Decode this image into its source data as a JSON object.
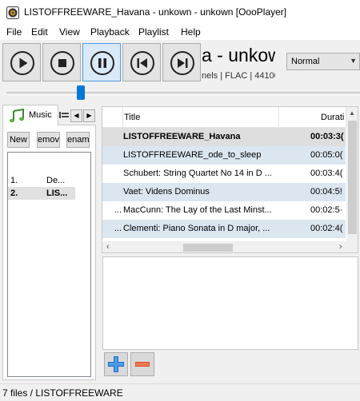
{
  "window": {
    "title": "LISTOFFREEWARE_Havana - unkown - unkown [OooPlayer]"
  },
  "menu": [
    "File",
    "Edit",
    "View",
    "Playback",
    "Playlist",
    "Help"
  ],
  "now_playing": {
    "title_scroll": "a - unkow",
    "info_scroll": "nels | FLAC | 44100"
  },
  "mode_select": {
    "value": "Normal"
  },
  "seek": {
    "position": 0.21
  },
  "left_panel": {
    "tab_label": "Music",
    "buttons": {
      "new": "New",
      "remove": "emov",
      "rename": "enam"
    },
    "playlists": [
      {
        "num": "1.",
        "name": "De..."
      },
      {
        "num": "2.",
        "name": "LIS..."
      }
    ]
  },
  "track_table": {
    "columns": {
      "title": "Title",
      "duration": "Durati"
    },
    "rows": [
      {
        "lead": "",
        "title": "LISTOFFREEWARE_Havana",
        "duration": "00:03:3("
      },
      {
        "lead": "",
        "title": "LISTOFFREEWARE_ode_to_sleep",
        "duration": "00:05:0("
      },
      {
        "lead": "",
        "title": "Schubert: String Quartet No 14 in D ...",
        "duration": "00:03:4("
      },
      {
        "lead": "",
        "title": "Vaet: Videns Dominus",
        "duration": "00:04:5!"
      },
      {
        "lead": "...",
        "title": "MacCunn: The Lay of the Last Minst...",
        "duration": "00:02:5·"
      },
      {
        "lead": "...",
        "title": "Clementi: Piano Sonata in D major, ...",
        "duration": "00:02:4("
      }
    ]
  },
  "statusbar": {
    "text": "7 files / LISTOFFREEWARE"
  },
  "colors": {
    "accent": "#0078d7",
    "row_alt": "#dbe6f1",
    "row_current": "#dedede"
  }
}
